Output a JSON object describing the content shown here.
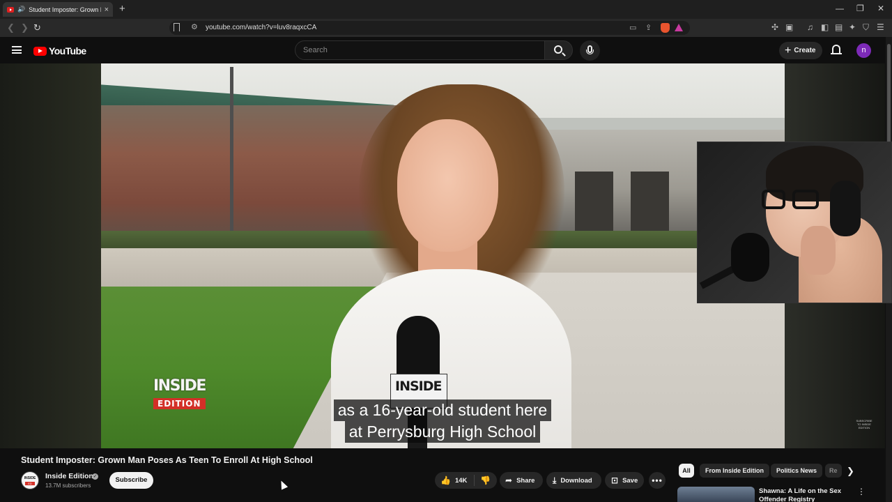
{
  "browser": {
    "tab_title": "Student Imposter: Grown Ma",
    "url": "youtube.com/watch?v=luv8raqxcCA",
    "new_tab": "+",
    "tab_close": "×",
    "min": "—",
    "restore": "❐",
    "close": "✕"
  },
  "masthead": {
    "logo_text": "YouTube",
    "search_placeholder": "Search",
    "create_label": "Create",
    "avatar_letter": "n"
  },
  "player": {
    "captions": [
      "as a 16-year-old student here",
      "at Perrysburg High School"
    ],
    "logo_top": "INSIDE",
    "logo_bottom": "EDITION",
    "mic_flag": "INSIDE",
    "watermark": "SUBSCRIBE TO INSIDE EDITION"
  },
  "video": {
    "title": "Student Imposter: Grown Man Poses As Teen To Enroll At High School",
    "channel_name": "Inside Edition",
    "subscribers": "13.7M subscribers",
    "subscribe_label": "Subscribe",
    "likes": "14K",
    "share_label": "Share",
    "download_label": "Download",
    "save_label": "Save"
  },
  "sidebar": {
    "chips": [
      "All",
      "From Inside Edition",
      "Politics News",
      "Re"
    ],
    "rec_title": "Shawna: A Life on the Sex Offender Registry"
  }
}
